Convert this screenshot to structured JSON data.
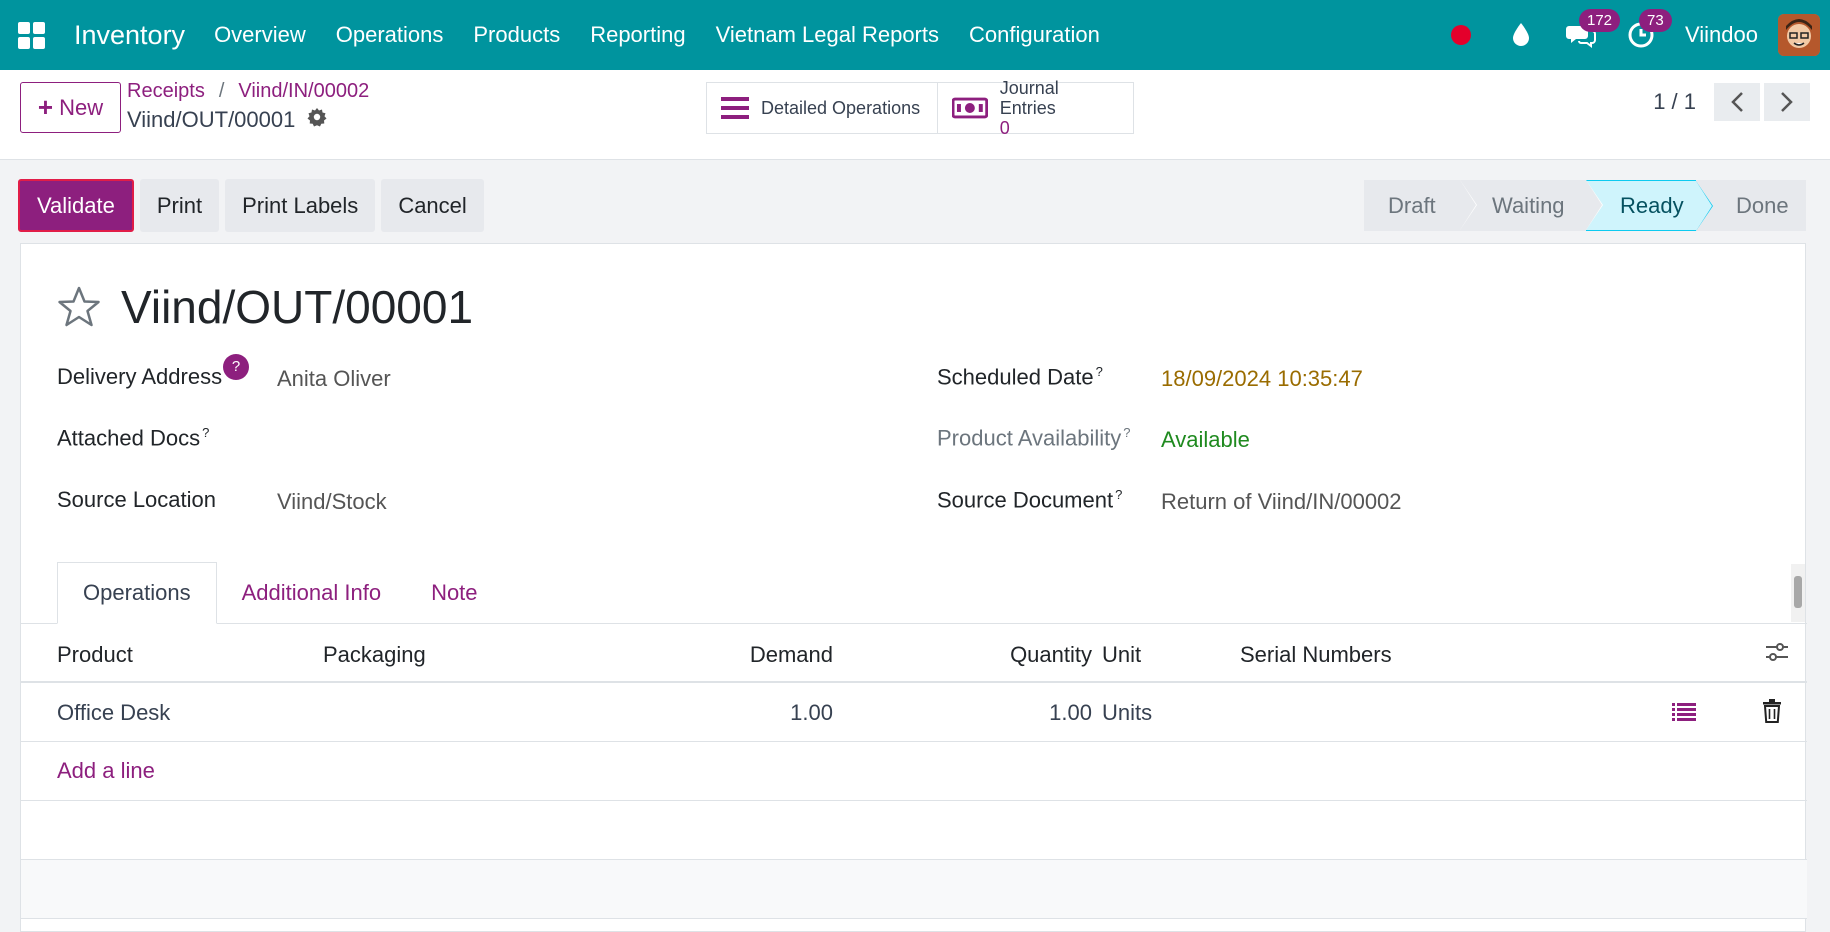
{
  "navbar": {
    "brand": "Inventory",
    "menu": [
      "Overview",
      "Operations",
      "Products",
      "Reporting",
      "Vietnam Legal Reports",
      "Configuration"
    ],
    "messages_count": "172",
    "activities_count": "73",
    "user_name": "Viindoo"
  },
  "control_panel": {
    "new_label": "New",
    "breadcrumb": [
      "Receipts",
      "Viind/IN/00002"
    ],
    "breadcrumb_sep": "/",
    "current_record": "Viind/OUT/00001",
    "smart_buttons": {
      "detailed_operations": "Detailed Operations",
      "journal_entries_label": "Journal Entries",
      "journal_entries_count": "0"
    },
    "pager": "1 / 1"
  },
  "actions": {
    "validate": "Validate",
    "print": "Print",
    "print_labels": "Print Labels",
    "cancel": "Cancel"
  },
  "status_stages": [
    "Draft",
    "Waiting",
    "Ready",
    "Done"
  ],
  "status_current": "Ready",
  "form": {
    "title": "Viind/OUT/00001",
    "delivery_address_label": "Delivery Address",
    "delivery_address_value": "Anita Oliver",
    "help_mark": "?",
    "attached_docs_label": "Attached Docs",
    "source_location_label": "Source Location",
    "source_location_value": "Viind/Stock",
    "scheduled_date_label": "Scheduled Date",
    "scheduled_date_value": "18/09/2024 10:35:47",
    "product_availability_label": "Product Availability",
    "product_availability_value": "Available",
    "source_document_label": "Source Document",
    "source_document_value": "Return of Viind/IN/00002",
    "sup": "?"
  },
  "tabs": [
    "Operations",
    "Additional Info",
    "Note"
  ],
  "table": {
    "headers": {
      "product": "Product",
      "packaging": "Packaging",
      "demand": "Demand",
      "quantity": "Quantity",
      "unit": "Unit",
      "serial_numbers": "Serial Numbers"
    },
    "rows": [
      {
        "product": "Office Desk",
        "demand": "1.00",
        "quantity": "1.00",
        "unit": "Units"
      }
    ],
    "add_line": "Add a line"
  },
  "colors": {
    "navbar": "#00949e",
    "brand_purple": "#8d1f7e",
    "scheduled_date": "#9a6c00",
    "available": "#1f8a1f"
  }
}
